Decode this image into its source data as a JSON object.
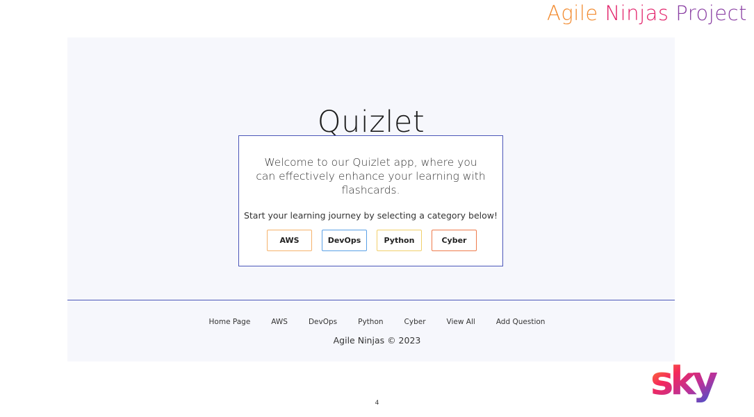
{
  "brand": {
    "title_parts": [
      "Agile ",
      "Ninjas ",
      "Project"
    ],
    "colors": [
      "#f28a2e",
      "#e2226a",
      "#8a3fa3"
    ]
  },
  "main": {
    "title": "Quizlet",
    "card": {
      "welcome": "Welcome to our Quizlet app, where you can effectively enhance your learning with flashcards.",
      "subtext": "Start your learning journey by selecting a category below!",
      "categories": [
        {
          "label": "AWS",
          "color": "#f5b26b"
        },
        {
          "label": "DevOps",
          "color": "#5aa0e6"
        },
        {
          "label": "Python",
          "color": "#f1cf6a"
        },
        {
          "label": "Cyber",
          "color": "#ee7a4a"
        }
      ]
    }
  },
  "footer": {
    "links": [
      "Home Page",
      "AWS",
      "DevOps",
      "Python",
      "Cyber",
      "View All",
      "Add Question"
    ],
    "copyright": "Agile Ninjas © 2023"
  },
  "slide_number": "4",
  "logo": {
    "name": "sky-logo",
    "text": "sky"
  }
}
